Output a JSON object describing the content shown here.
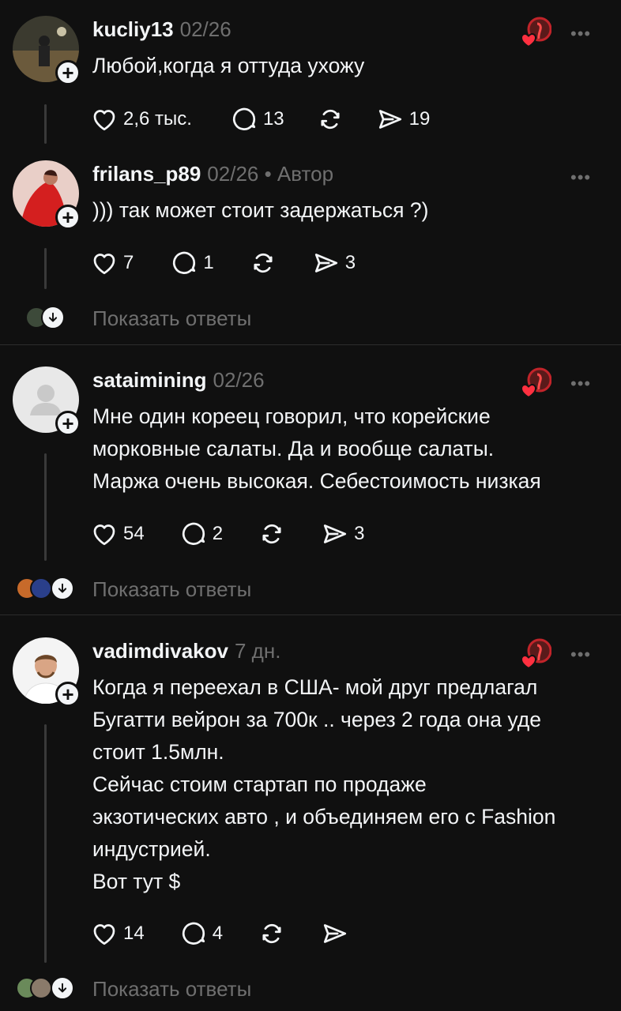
{
  "colors": {
    "background": "#101010",
    "text": "#f3f5f7",
    "muted": "#6f6f6f",
    "accent": "#ff3040"
  },
  "comments": [
    {
      "username": "kucliy13",
      "meta": "02/26",
      "text": "Любой,когда я оттуда ухожу",
      "likes": "2,6 тыс.",
      "replies": "13",
      "reposts": "",
      "shares": "19"
    },
    {
      "username": "frilans_p89",
      "meta": "02/26 • Автор",
      "text": "))) так может стоит задержаться ?)",
      "likes": "7",
      "replies": "1",
      "reposts": "",
      "shares": "3",
      "show_replies": "Показать ответы"
    },
    {
      "username": "sataimining",
      "meta": "02/26",
      "text": "Мне один кореец говорил, что корейские\nморковные салаты. Да и вообще салаты.\nМаржа очень высокая. Себестоимость низкая",
      "likes": "54",
      "replies": "2",
      "reposts": "",
      "shares": "3",
      "show_replies": "Показать ответы"
    },
    {
      "username": "vadimdivakov",
      "meta": "7 дн.",
      "text": "Когда я переехал в США- мой друг предлагал\nБугатти вейрон за 700к .. через 2 года она уде\nстоит 1.5млн.\nСейчас стоим стартап по продаже\nэкзотических авто , и объединяем его с Fashion\nиндустрией.\nВот тут $",
      "likes": "14",
      "replies": "4",
      "reposts": "",
      "shares": "",
      "show_replies": "Показать ответы"
    }
  ],
  "icons": {
    "like": "heart-icon",
    "reply": "comment-icon",
    "repost": "repost-icon",
    "share": "send-icon",
    "more": "more-icon",
    "follow": "plus-icon",
    "expand": "arrow-down-icon"
  },
  "more_glyph": "•••"
}
